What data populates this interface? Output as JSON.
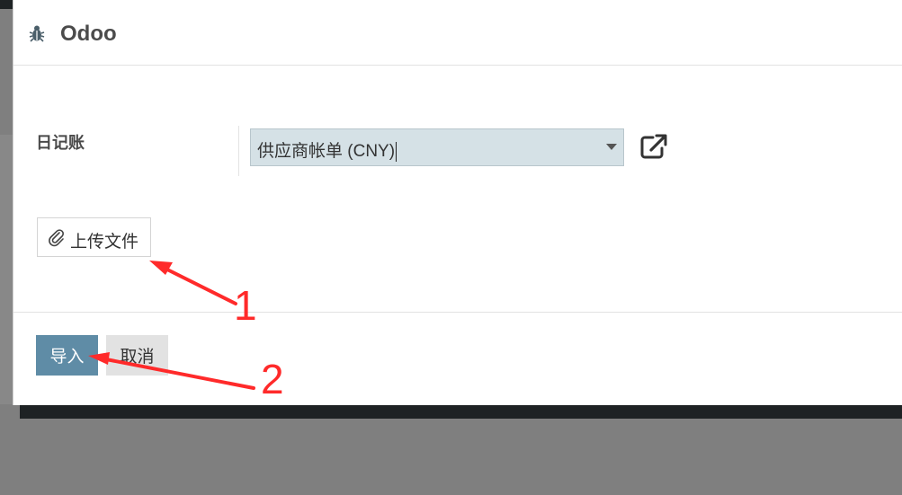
{
  "dialog": {
    "title": "Odoo",
    "title_icon": "bug-icon"
  },
  "form": {
    "journal_label": "日记账",
    "journal_value": "供应商帐单 (CNY)",
    "journal_external_icon": "external-link-icon"
  },
  "upload": {
    "icon": "paperclip-icon",
    "label": "上传文件"
  },
  "footer": {
    "import_label": "导入",
    "cancel_label": "取消"
  },
  "annotations": {
    "marker_1": "1",
    "marker_2": "2",
    "arrow_color": "#ff2a2a"
  },
  "colors": {
    "primary": "#5f8ca6",
    "select_bg": "#d5e1e6",
    "backdrop": "#7f7f7f"
  }
}
